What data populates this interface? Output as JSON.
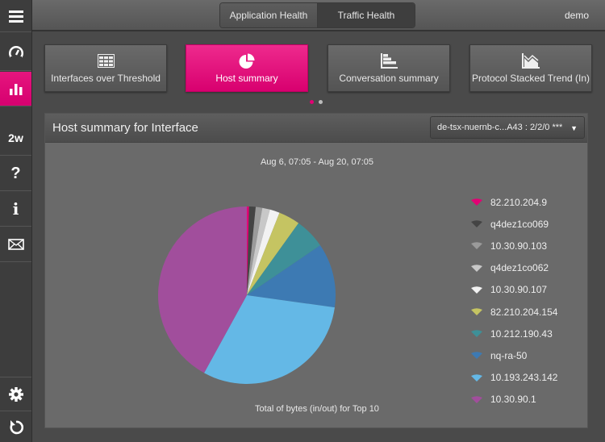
{
  "sidebar": {
    "items": [
      {
        "icon": "menu-icon"
      },
      {
        "icon": "dashboard-gauge-icon"
      },
      {
        "icon": "bar-chart-icon",
        "active": true
      },
      {
        "icon": "timeframe",
        "label": "2w"
      },
      {
        "icon": "help-icon",
        "label": "?"
      },
      {
        "icon": "info-icon",
        "label": "i"
      },
      {
        "icon": "mail-icon"
      },
      {
        "icon": "settings-gear-icon"
      },
      {
        "icon": "refresh-icon"
      }
    ]
  },
  "topbar": {
    "tabs": [
      {
        "label": "Application Health",
        "selected": false
      },
      {
        "label": "Traffic Health",
        "selected": true
      }
    ],
    "user": "demo"
  },
  "tiles": [
    {
      "label": "Interfaces over Threshold",
      "icon": "table-icon",
      "active": false
    },
    {
      "label": "Host summary",
      "icon": "pie-chart-icon",
      "active": true
    },
    {
      "label": "Conversation summary",
      "icon": "horizontal-bar-icon",
      "active": false
    },
    {
      "label": "Protocol Stacked Trend (In)",
      "icon": "area-chart-icon",
      "active": false
    }
  ],
  "pager": {
    "pages": 2,
    "current": 1
  },
  "colors": {
    "accent": "#e20074",
    "dot_inactive": "#bbbbbb"
  },
  "panel": {
    "title": "Host summary for Interface",
    "interface_select": "de-tsx-nuernb-c...A43 : 2/2/0 ***"
  },
  "chart_data": {
    "type": "pie",
    "title": "Aug 6, 07:05 - Aug 20, 07:05",
    "xlabel": "Total of bytes (in/out) for Top 10",
    "legend_position": "right",
    "unit": "percent of total bytes (estimated)",
    "series": [
      {
        "name": "82.210.204.9",
        "value": 0.4,
        "color": "#e20074"
      },
      {
        "name": "q4dez1co069",
        "value": 1.2,
        "color": "#444444"
      },
      {
        "name": "10.30.90.103",
        "value": 1.2,
        "color": "#9a9a9a"
      },
      {
        "name": "q4dez1co062",
        "value": 1.4,
        "color": "#c8c8c8"
      },
      {
        "name": "10.30.90.107",
        "value": 1.8,
        "color": "#f2f2f2"
      },
      {
        "name": "82.210.204.154",
        "value": 3.9,
        "color": "#c5c462"
      },
      {
        "name": "10.212.190.43",
        "value": 5.6,
        "color": "#3e9098"
      },
      {
        "name": "nq-ra-50",
        "value": 11.7,
        "color": "#3d7ab3"
      },
      {
        "name": "10.193.243.142",
        "value": 30.8,
        "color": "#64b8e6"
      },
      {
        "name": "10.30.90.1",
        "value": 42.0,
        "color": "#a14e9c"
      }
    ]
  }
}
